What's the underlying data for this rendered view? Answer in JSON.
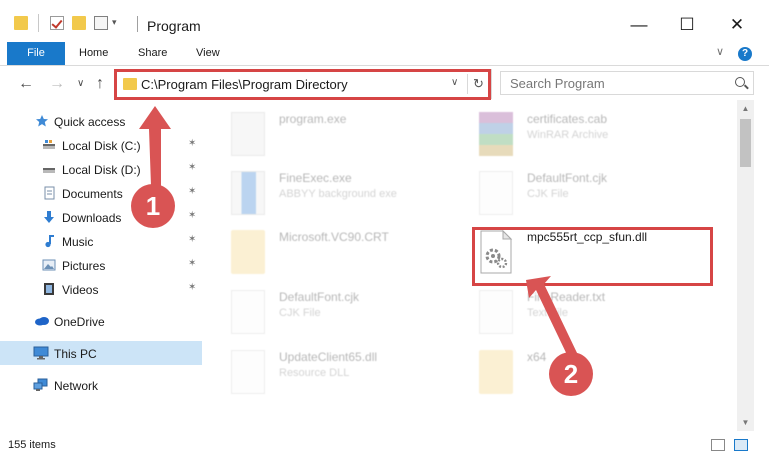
{
  "window": {
    "title": "Program",
    "minimize": "—",
    "maximize": "☐",
    "close": "✕"
  },
  "ribbon": {
    "tabs": [
      {
        "label": "File"
      },
      {
        "label": "Home"
      },
      {
        "label": "Share"
      },
      {
        "label": "View"
      }
    ],
    "collapse": "∨",
    "help": "?"
  },
  "nav": {
    "back": "←",
    "forward": "→",
    "history": "∨",
    "up": "↑"
  },
  "address": {
    "path": "C:\\Program Files\\Program Directory",
    "dropdown": "∨",
    "refresh": "↻"
  },
  "search": {
    "placeholder": "Search Program"
  },
  "sidebar": {
    "items": [
      {
        "label": "Quick access",
        "icon": "star-icon",
        "pinned": false,
        "selected": false
      },
      {
        "label": "Local Disk (C:)",
        "icon": "drive-icon",
        "pinned": true,
        "selected": false
      },
      {
        "label": "Local Disk (D:)",
        "icon": "drive-icon",
        "pinned": true,
        "selected": false
      },
      {
        "label": "Documents",
        "icon": "documents-icon",
        "pinned": true,
        "selected": false
      },
      {
        "label": "Downloads",
        "icon": "download-icon",
        "pinned": true,
        "selected": false
      },
      {
        "label": "Music",
        "icon": "music-icon",
        "pinned": true,
        "selected": false
      },
      {
        "label": "Pictures",
        "icon": "pictures-icon",
        "pinned": true,
        "selected": false
      },
      {
        "label": "Videos",
        "icon": "videos-icon",
        "pinned": true,
        "selected": false
      },
      {
        "label": "OneDrive",
        "icon": "cloud-icon",
        "pinned": false,
        "selected": false
      },
      {
        "label": "This PC",
        "icon": "computer-icon",
        "pinned": false,
        "selected": true
      },
      {
        "label": "Network",
        "icon": "network-icon",
        "pinned": false,
        "selected": false
      }
    ],
    "pin_glyph": "✶"
  },
  "files": [
    {
      "name": "program.exe",
      "type": "",
      "icon": "exe-icon",
      "highlight": false
    },
    {
      "name": "certificates.cab",
      "type": "WinRAR Archive",
      "icon": "archive-icon",
      "highlight": false
    },
    {
      "name": "FineExec.exe",
      "type": "ABBYY background exe",
      "icon": "exe-icon",
      "highlight": false
    },
    {
      "name": "DefaultFont.cjk",
      "type": "CJK File",
      "icon": "file-icon",
      "highlight": false
    },
    {
      "name": "Microsoft.VC90.CRT",
      "type": "",
      "icon": "folder-icon",
      "highlight": false
    },
    {
      "name": "mpc555rt_ccp_sfun.dll",
      "type": "",
      "icon": "dll-icon",
      "highlight": true
    },
    {
      "name": "DefaultFont.cjk",
      "type": "CJK File",
      "icon": "file-icon",
      "highlight": false
    },
    {
      "name": "FineReader.txt",
      "type": "Text File",
      "icon": "file-icon",
      "highlight": false
    },
    {
      "name": "UpdateClient65.dll",
      "type": "Resource DLL",
      "icon": "dll-icon",
      "highlight": false
    },
    {
      "name": "x64",
      "type": "",
      "icon": "folder-icon",
      "highlight": false
    }
  ],
  "status": {
    "items_count": "155 items"
  },
  "callouts": [
    {
      "number": "1"
    },
    {
      "number": "2"
    }
  ],
  "colors": {
    "accent": "#1979ca",
    "highlight": "#d64545",
    "callout": "#d95454",
    "selection": "#cce4f7"
  }
}
